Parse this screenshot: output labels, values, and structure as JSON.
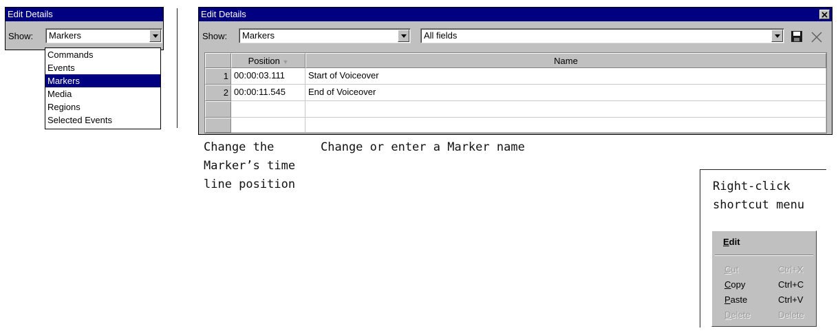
{
  "small_window": {
    "title": "Edit Details",
    "show_label": "Show:",
    "show_value": "Markers",
    "options": [
      "Commands",
      "Events",
      "Markers",
      "Media",
      "Regions",
      "Selected Events"
    ],
    "selected_option": "Markers"
  },
  "main_window": {
    "title": "Edit Details",
    "show_label": "Show:",
    "show_value": "Markers",
    "fields_value": "All fields",
    "columns": [
      "Position",
      "Name"
    ],
    "rows": [
      {
        "num": "1",
        "position": "00:00:03.111",
        "name": "Start of Voiceover"
      },
      {
        "num": "2",
        "position": "00:00:11.545",
        "name": "End of Voiceover"
      },
      {
        "num": "",
        "position": "",
        "name": ""
      },
      {
        "num": "",
        "position": "",
        "name": ""
      }
    ]
  },
  "captions": {
    "position_line1": "Change the",
    "position_line2": "Marker’s time",
    "position_line3": "line position",
    "name": "Change or enter a Marker name",
    "menu_line1": "Right-click",
    "menu_line2": "shortcut menu"
  },
  "context_menu": {
    "header_letter": "E",
    "header_rest": "dit",
    "items": [
      {
        "key": "C",
        "label_rest": "ut",
        "shortcut": "Ctrl+X",
        "enabled": false
      },
      {
        "key": "C",
        "label_rest": "opy",
        "shortcut": "Ctrl+C",
        "enabled": true
      },
      {
        "key": "P",
        "label_rest": "aste",
        "shortcut": "Ctrl+V",
        "enabled": true
      },
      {
        "key": "D",
        "label_rest": "elete",
        "shortcut": "Delete",
        "enabled": false
      }
    ]
  }
}
